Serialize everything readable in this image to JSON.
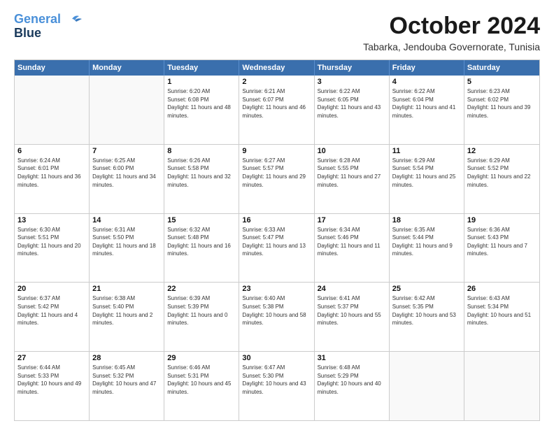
{
  "logo": {
    "line1": "General",
    "line2": "Blue"
  },
  "title": "October 2024",
  "subtitle": "Tabarka, Jendouba Governorate, Tunisia",
  "days_of_week": [
    "Sunday",
    "Monday",
    "Tuesday",
    "Wednesday",
    "Thursday",
    "Friday",
    "Saturday"
  ],
  "weeks": [
    [
      {
        "day": "",
        "info": ""
      },
      {
        "day": "",
        "info": ""
      },
      {
        "day": "1",
        "info": "Sunrise: 6:20 AM\nSunset: 6:08 PM\nDaylight: 11 hours and 48 minutes."
      },
      {
        "day": "2",
        "info": "Sunrise: 6:21 AM\nSunset: 6:07 PM\nDaylight: 11 hours and 46 minutes."
      },
      {
        "day": "3",
        "info": "Sunrise: 6:22 AM\nSunset: 6:05 PM\nDaylight: 11 hours and 43 minutes."
      },
      {
        "day": "4",
        "info": "Sunrise: 6:22 AM\nSunset: 6:04 PM\nDaylight: 11 hours and 41 minutes."
      },
      {
        "day": "5",
        "info": "Sunrise: 6:23 AM\nSunset: 6:02 PM\nDaylight: 11 hours and 39 minutes."
      }
    ],
    [
      {
        "day": "6",
        "info": "Sunrise: 6:24 AM\nSunset: 6:01 PM\nDaylight: 11 hours and 36 minutes."
      },
      {
        "day": "7",
        "info": "Sunrise: 6:25 AM\nSunset: 6:00 PM\nDaylight: 11 hours and 34 minutes."
      },
      {
        "day": "8",
        "info": "Sunrise: 6:26 AM\nSunset: 5:58 PM\nDaylight: 11 hours and 32 minutes."
      },
      {
        "day": "9",
        "info": "Sunrise: 6:27 AM\nSunset: 5:57 PM\nDaylight: 11 hours and 29 minutes."
      },
      {
        "day": "10",
        "info": "Sunrise: 6:28 AM\nSunset: 5:55 PM\nDaylight: 11 hours and 27 minutes."
      },
      {
        "day": "11",
        "info": "Sunrise: 6:29 AM\nSunset: 5:54 PM\nDaylight: 11 hours and 25 minutes."
      },
      {
        "day": "12",
        "info": "Sunrise: 6:29 AM\nSunset: 5:52 PM\nDaylight: 11 hours and 22 minutes."
      }
    ],
    [
      {
        "day": "13",
        "info": "Sunrise: 6:30 AM\nSunset: 5:51 PM\nDaylight: 11 hours and 20 minutes."
      },
      {
        "day": "14",
        "info": "Sunrise: 6:31 AM\nSunset: 5:50 PM\nDaylight: 11 hours and 18 minutes."
      },
      {
        "day": "15",
        "info": "Sunrise: 6:32 AM\nSunset: 5:48 PM\nDaylight: 11 hours and 16 minutes."
      },
      {
        "day": "16",
        "info": "Sunrise: 6:33 AM\nSunset: 5:47 PM\nDaylight: 11 hours and 13 minutes."
      },
      {
        "day": "17",
        "info": "Sunrise: 6:34 AM\nSunset: 5:46 PM\nDaylight: 11 hours and 11 minutes."
      },
      {
        "day": "18",
        "info": "Sunrise: 6:35 AM\nSunset: 5:44 PM\nDaylight: 11 hours and 9 minutes."
      },
      {
        "day": "19",
        "info": "Sunrise: 6:36 AM\nSunset: 5:43 PM\nDaylight: 11 hours and 7 minutes."
      }
    ],
    [
      {
        "day": "20",
        "info": "Sunrise: 6:37 AM\nSunset: 5:42 PM\nDaylight: 11 hours and 4 minutes."
      },
      {
        "day": "21",
        "info": "Sunrise: 6:38 AM\nSunset: 5:40 PM\nDaylight: 11 hours and 2 minutes."
      },
      {
        "day": "22",
        "info": "Sunrise: 6:39 AM\nSunset: 5:39 PM\nDaylight: 11 hours and 0 minutes."
      },
      {
        "day": "23",
        "info": "Sunrise: 6:40 AM\nSunset: 5:38 PM\nDaylight: 10 hours and 58 minutes."
      },
      {
        "day": "24",
        "info": "Sunrise: 6:41 AM\nSunset: 5:37 PM\nDaylight: 10 hours and 55 minutes."
      },
      {
        "day": "25",
        "info": "Sunrise: 6:42 AM\nSunset: 5:35 PM\nDaylight: 10 hours and 53 minutes."
      },
      {
        "day": "26",
        "info": "Sunrise: 6:43 AM\nSunset: 5:34 PM\nDaylight: 10 hours and 51 minutes."
      }
    ],
    [
      {
        "day": "27",
        "info": "Sunrise: 6:44 AM\nSunset: 5:33 PM\nDaylight: 10 hours and 49 minutes."
      },
      {
        "day": "28",
        "info": "Sunrise: 6:45 AM\nSunset: 5:32 PM\nDaylight: 10 hours and 47 minutes."
      },
      {
        "day": "29",
        "info": "Sunrise: 6:46 AM\nSunset: 5:31 PM\nDaylight: 10 hours and 45 minutes."
      },
      {
        "day": "30",
        "info": "Sunrise: 6:47 AM\nSunset: 5:30 PM\nDaylight: 10 hours and 43 minutes."
      },
      {
        "day": "31",
        "info": "Sunrise: 6:48 AM\nSunset: 5:29 PM\nDaylight: 10 hours and 40 minutes."
      },
      {
        "day": "",
        "info": ""
      },
      {
        "day": "",
        "info": ""
      }
    ]
  ]
}
